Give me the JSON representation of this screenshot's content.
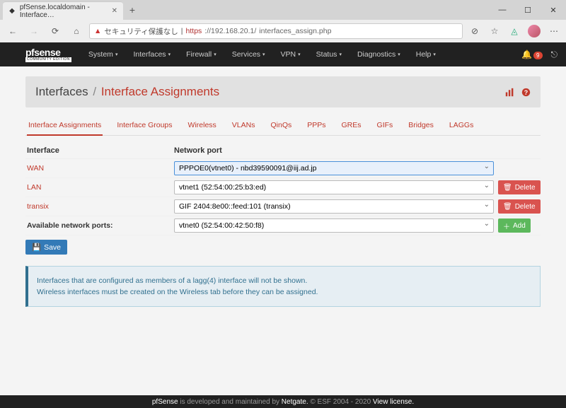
{
  "browser": {
    "tab_title": "pfSense.localdomain - Interface…",
    "url_insecure_label": "セキュリティ保護なし",
    "url_https": "https",
    "url_host": "://192.168.20.1/",
    "url_path": "interfaces_assign.php"
  },
  "brand": {
    "main": "pfsense",
    "sub": "COMMUNITY EDITION"
  },
  "nav": {
    "items": [
      "System",
      "Interfaces",
      "Firewall",
      "Services",
      "VPN",
      "Status",
      "Diagnostics",
      "Help"
    ],
    "notif_count": "9"
  },
  "header": {
    "main": "Interfaces",
    "sub": "Interface Assignments"
  },
  "tabs": [
    "Interface Assignments",
    "Interface Groups",
    "Wireless",
    "VLANs",
    "QinQs",
    "PPPs",
    "GREs",
    "GIFs",
    "Bridges",
    "LAGGs"
  ],
  "columns": {
    "interface": "Interface",
    "port": "Network port"
  },
  "rows": {
    "wan": {
      "label": "WAN",
      "port": "PPPOE0(vtnet0) - nbd39590091@iij.ad.jp"
    },
    "lan": {
      "label": "LAN",
      "port": "vtnet1 (52:54:00:25:b3:ed)"
    },
    "transix": {
      "label": "transix",
      "port": "GIF 2404:8e00::feed:101 (transix)"
    },
    "avail": {
      "label": "Available network ports:",
      "port": "vtnet0 (52:54:00:42:50:f8)"
    }
  },
  "buttons": {
    "delete": "Delete",
    "add": "Add",
    "save": "Save"
  },
  "info": {
    "l1": "Interfaces that are configured as members of a lagg(4) interface will not be shown.",
    "l2": "Wireless interfaces must be created on the Wireless tab before they can be assigned."
  },
  "footer": {
    "t1": "pfSense",
    "t2": " is developed and maintained by ",
    "t3": "Netgate.",
    "t4": " © ESF 2004 - 2020 ",
    "t5": "View license."
  }
}
